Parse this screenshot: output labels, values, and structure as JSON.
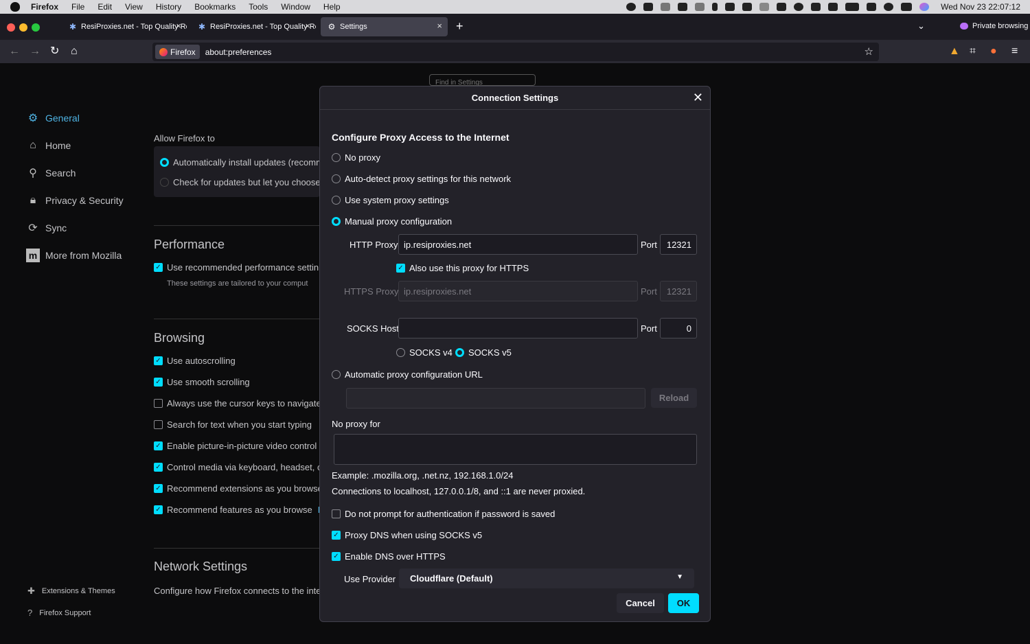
{
  "menubar": {
    "app": "Firefox",
    "items": [
      "File",
      "Edit",
      "View",
      "History",
      "Bookmarks",
      "Tools",
      "Window",
      "Help"
    ],
    "clock": "Wed Nov 23  22:07:12"
  },
  "tabs": [
    {
      "title": "ResiProxies.net - Top Quality Re"
    },
    {
      "title": "ResiProxies.net - Top Quality Re"
    },
    {
      "title": "Settings"
    }
  ],
  "private_label": "Private browsing",
  "urlbar": {
    "identity": "Firefox",
    "url": "about:preferences"
  },
  "search_placeholder": "Find in Settings",
  "sidebar": {
    "items": [
      "General",
      "Home",
      "Search",
      "Privacy & Security",
      "Sync",
      "More from Mozilla"
    ],
    "footer": [
      "Extensions & Themes",
      "Firefox Support"
    ]
  },
  "prefs": {
    "allow_label": "Allow Firefox to",
    "update_auto": "Automatically install updates (recomm",
    "update_check": "Check for updates but let you choose",
    "performance_head": "Performance",
    "perf_recommended": "Use recommended performance settin",
    "perf_note": "These settings are tailored to your comput",
    "browsing_head": "Browsing",
    "browsing": [
      {
        "label": "Use autoscrolling",
        "checked": true
      },
      {
        "label": "Use smooth scrolling",
        "checked": true
      },
      {
        "label": "Always use the cursor keys to navigate",
        "checked": false
      },
      {
        "label": "Search for text when you start typing",
        "checked": false
      },
      {
        "label": "Enable picture-in-picture video control",
        "checked": true
      },
      {
        "label": "Control media via keyboard, headset, c",
        "checked": true
      },
      {
        "label": "Recommend extensions as you browse",
        "checked": true
      },
      {
        "label": "Recommend features as you browse",
        "checked": true
      }
    ],
    "learn_more_fragment": "L",
    "network_head": "Network Settings",
    "network_desc": "Configure how Firefox connects to the inte"
  },
  "dialog": {
    "title": "Connection Settings",
    "heading": "Configure Proxy Access to the Internet",
    "options": [
      {
        "label": "No proxy",
        "selected": false
      },
      {
        "label": "Auto-detect proxy settings for this network",
        "selected": false
      },
      {
        "label": "Use system proxy settings",
        "selected": false
      },
      {
        "label": "Manual proxy configuration",
        "selected": true
      }
    ],
    "http_proxy_label": "HTTP Proxy",
    "http_proxy_value": "ip.resiproxies.net",
    "port_label": "Port",
    "http_port": "12321",
    "also_https_label": "Also use this proxy for HTTPS",
    "https_proxy_label": "HTTPS Proxy",
    "https_proxy_value": "ip.resiproxies.net",
    "https_port": "12321",
    "socks_host_label": "SOCKS Host",
    "socks_host_value": "",
    "socks_port": "0",
    "socks_v4": "SOCKS v4",
    "socks_v5": "SOCKS v5",
    "auto_url_label": "Automatic proxy configuration URL",
    "reload_label": "Reload",
    "no_proxy_label": "No proxy for",
    "example_text": "Example: .mozilla.org, .net.nz, 192.168.1.0/24",
    "localhost_text": "Connections to localhost, 127.0.0.1/8, and ::1 are never proxied.",
    "no_prompt_auth": "Do not prompt for authentication if password is saved",
    "proxy_dns": "Proxy DNS when using SOCKS v5",
    "enable_doh": "Enable DNS over HTTPS",
    "provider_label": "Use Provider",
    "provider_value": "Cloudflare (Default)",
    "cancel_label": "Cancel",
    "ok_label": "OK"
  },
  "colors": {
    "accent": "#00ddff",
    "sidebar_active": "#4fb4e4",
    "dialog_bg": "#232229"
  }
}
